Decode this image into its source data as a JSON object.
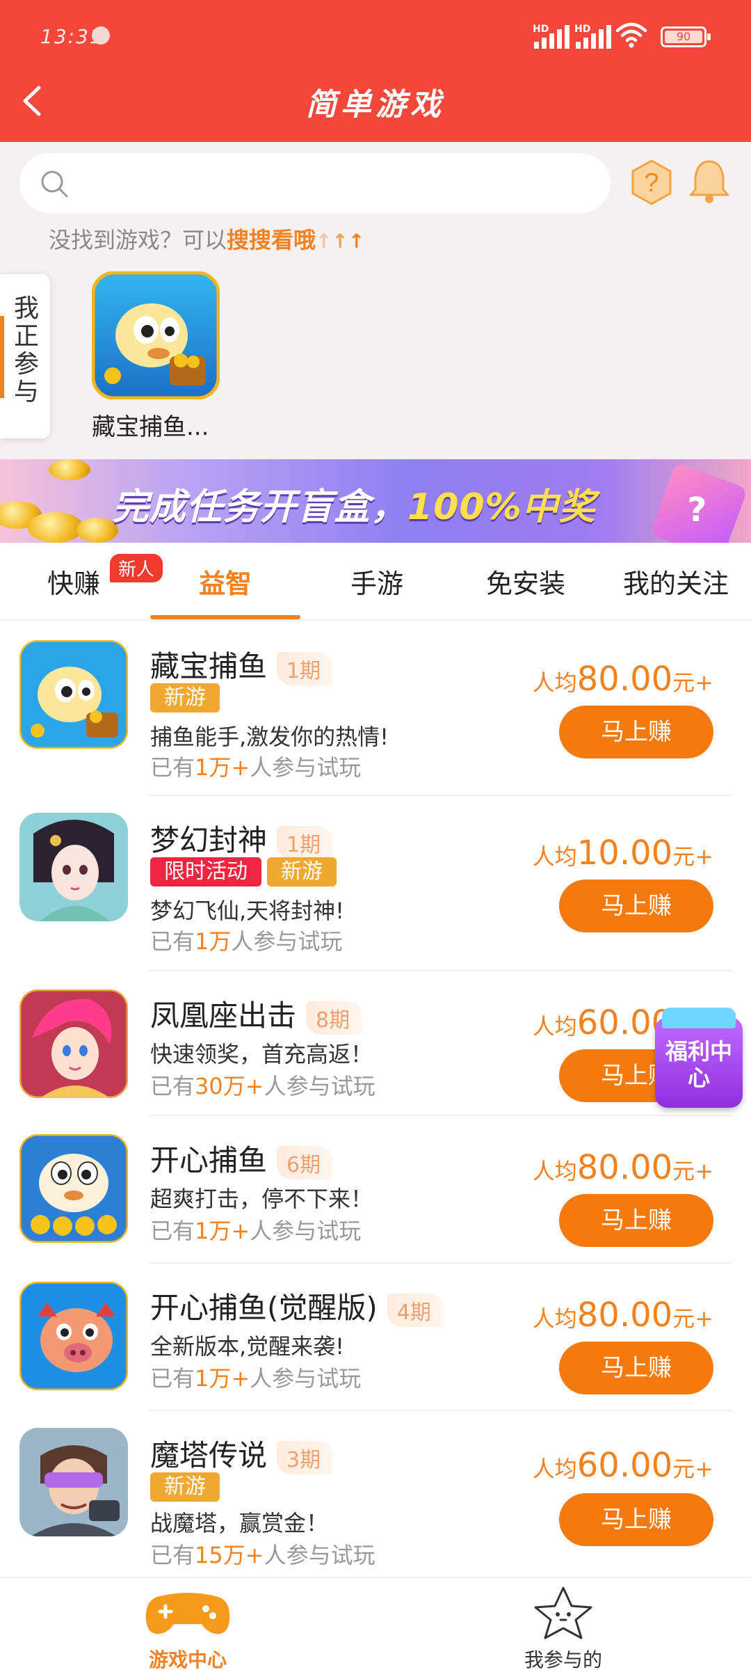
{
  "status_bar": {
    "time": "13:31",
    "signal1_label": "HD",
    "signal2_label": "HD",
    "battery": "90"
  },
  "header": {
    "title": "简单游戏",
    "back_icon": "back-arrow-icon"
  },
  "search": {
    "placeholder": "",
    "hint_prefix": "没找到游戏？可以",
    "hint_link": "搜搜看哦",
    "hint_arrows": "↑↑↑"
  },
  "joined_tab": {
    "label": "我正参与"
  },
  "recent_games": [
    {
      "label": "藏宝捕鱼..."
    }
  ],
  "banner": {
    "text_main": "完成任务开盲盒，",
    "text_highlight": "100%中奖",
    "gem_mark": "?"
  },
  "tabs": [
    {
      "label": "快赚",
      "badge": "新人"
    },
    {
      "label": "益智",
      "active": true
    },
    {
      "label": "手游"
    },
    {
      "label": "免安装"
    },
    {
      "label": "我的关注"
    }
  ],
  "games": [
    {
      "name": "藏宝捕鱼",
      "period": "1期",
      "tags": [
        "新游"
      ],
      "desc": "捕鱼能手,激发你的热情!",
      "players_prefix": "已有",
      "players_count": "1万+",
      "players_suffix": "人参与试玩",
      "reward_prefix": "人均",
      "reward_amount": "80.00",
      "reward_suffix": "元+",
      "button": "马上赚",
      "icon": "golden-puffer-fish-icon"
    },
    {
      "name": "梦幻封神",
      "period": "1期",
      "tags": [
        "限时活动",
        "新游"
      ],
      "desc": "梦幻飞仙,天将封神!",
      "players_prefix": "已有",
      "players_count": "1万",
      "players_suffix": "人参与试玩",
      "reward_prefix": "人均",
      "reward_amount": "10.00",
      "reward_suffix": "元+",
      "button": "马上赚",
      "icon": "fantasy-girl-icon"
    },
    {
      "name": "凤凰座出击",
      "period": "8期",
      "tags": [],
      "desc": "快速领奖，首充高返！",
      "players_prefix": "已有",
      "players_count": "30万+",
      "players_suffix": "人参与试玩",
      "reward_prefix": "人均",
      "reward_amount": "60.00",
      "reward_suffix": "元+",
      "button": "马上赚",
      "icon": "pink-hair-hero-icon"
    },
    {
      "name": "开心捕鱼",
      "period": "6期",
      "tags": [],
      "desc": "超爽打击，停不下来！",
      "players_prefix": "已有",
      "players_count": "1万+",
      "players_suffix": "人参与试玩",
      "reward_prefix": "人均",
      "reward_amount": "80.00",
      "reward_suffix": "元+",
      "button": "马上赚",
      "icon": "blue-puffer-fish-icon"
    },
    {
      "name": "开心捕鱼(觉醒版)",
      "period": "4期",
      "tags": [],
      "desc": "全新版本,觉醒来袭!",
      "players_prefix": "已有",
      "players_count": "1万+",
      "players_suffix": "人参与试玩",
      "reward_prefix": "人均",
      "reward_amount": "80.00",
      "reward_suffix": "元+",
      "button": "马上赚",
      "icon": "pig-fish-icon"
    },
    {
      "name": "魔塔传说",
      "period": "3期",
      "tags": [
        "新游"
      ],
      "desc": "战魔塔，赢赏金！",
      "players_prefix": "已有",
      "players_count": "15万+",
      "players_suffix": "人参与试玩",
      "reward_prefix": "人均",
      "reward_amount": "60.00",
      "reward_suffix": "元+",
      "button": "马上赚",
      "icon": "tower-warrior-icon"
    }
  ],
  "welfare": {
    "label": "福利中心"
  },
  "bottom_nav": [
    {
      "label": "游戏中心",
      "active": true,
      "icon": "gamepad-icon"
    },
    {
      "label": "我参与的",
      "icon": "star-face-icon"
    }
  ],
  "colors": {
    "header": "#f4473a",
    "accent": "#f3811e",
    "button": "#f57a0e",
    "tag_new": "#f0a930",
    "tag_limited": "#ef2440"
  }
}
